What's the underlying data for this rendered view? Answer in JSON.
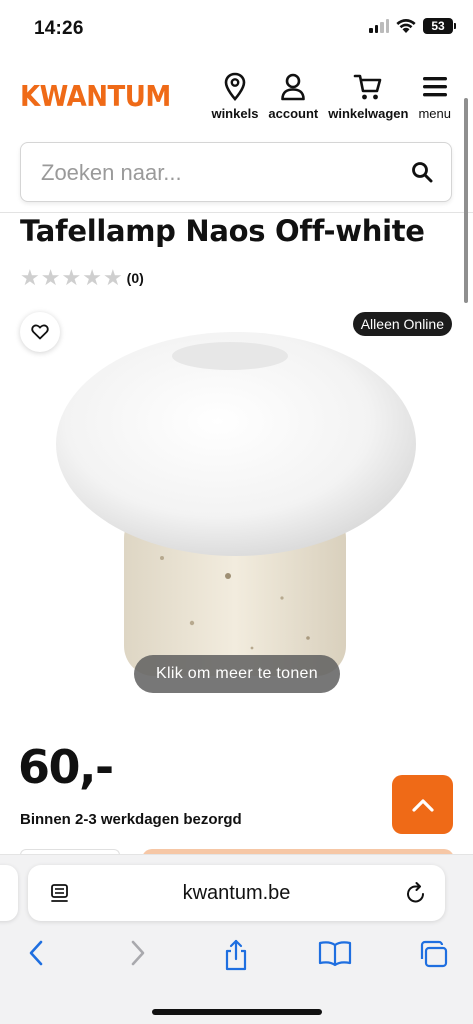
{
  "status_bar": {
    "time": "14:26",
    "battery": "53"
  },
  "header": {
    "logo": "KWANTUM",
    "nav": [
      {
        "icon": "location-pin-icon",
        "label": "winkels"
      },
      {
        "icon": "account-icon",
        "label": "account"
      },
      {
        "icon": "cart-icon",
        "label": "winkelwagen"
      },
      {
        "icon": "menu-icon",
        "label": "menu"
      }
    ]
  },
  "search": {
    "placeholder": "Zoeken naar..."
  },
  "product": {
    "title": "Tafellamp Naos Off-white",
    "rating_count": "(0)",
    "badge": "Alleen Online",
    "image_hint": "Klik om meer te tonen",
    "price": "60,-",
    "delivery": "Binnen 2-3 werkdagen bezorgd"
  },
  "browser": {
    "url": "kwantum.be"
  },
  "colors": {
    "brand": "#ef6a17",
    "ios_blue": "#1f6fe0"
  }
}
